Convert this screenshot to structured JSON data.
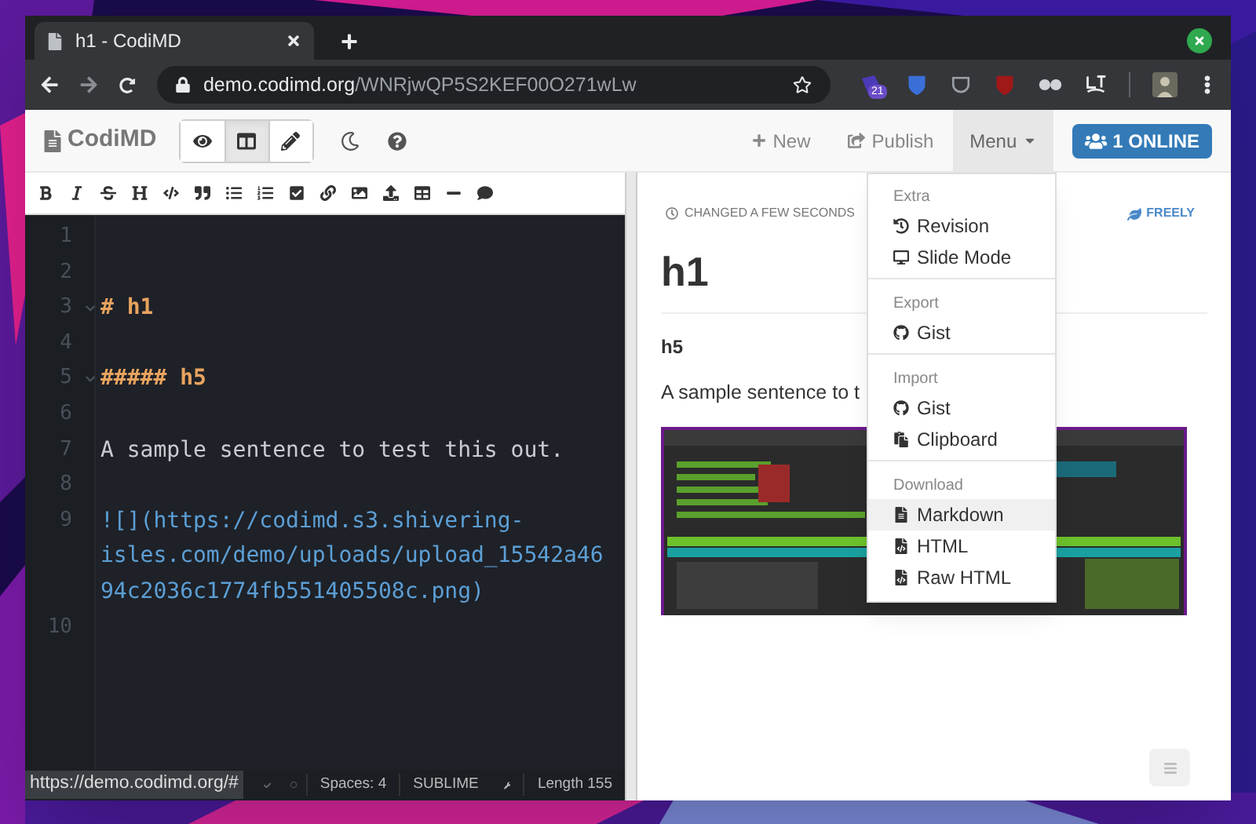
{
  "browser": {
    "tab_title": "h1 - CodiMD",
    "url_host": "demo.codimd.org",
    "url_path": "/WNRjwQP5S2KEF00O271wLw",
    "extension_badge": "21"
  },
  "navbar": {
    "brand": "CodiMD",
    "view_modes": [
      {
        "kind": "view",
        "selected": false
      },
      {
        "kind": "both",
        "selected": true
      },
      {
        "kind": "edit",
        "selected": false
      }
    ],
    "new": "New",
    "publish": "Publish",
    "menu": "Menu",
    "menu_open": true,
    "online": "1 ONLINE"
  },
  "editor": {
    "lines": [
      {
        "number": "1",
        "kind": "blank",
        "foldable": false
      },
      {
        "number": "2",
        "kind": "blank",
        "foldable": false
      },
      {
        "number": "3",
        "kind": "heading",
        "text": "# h1",
        "foldable": true
      },
      {
        "number": "4",
        "kind": "blank",
        "foldable": false
      },
      {
        "number": "5",
        "kind": "heading",
        "text": "##### h5",
        "foldable": true
      },
      {
        "number": "6",
        "kind": "blank",
        "foldable": false
      },
      {
        "number": "7",
        "kind": "text",
        "text": "A sample sentence to test this out.",
        "foldable": false
      },
      {
        "number": "8",
        "kind": "blank",
        "foldable": false
      },
      {
        "number": "9",
        "kind": "link",
        "text": "![](https://codimd.s3.shivering-isles.com/demo/uploads/upload_15542a4694c2036c1774fb551405508c.png)",
        "foldable": false
      },
      {
        "number": "10",
        "kind": "blank",
        "foldable": false
      }
    ]
  },
  "status_bar": {
    "link_preview": "https://demo.codimd.org/#",
    "spaces": "Spaces: 4",
    "keymap": "SUBLIME",
    "length": "Length 155"
  },
  "preview": {
    "changed": "CHANGED A FEW SECONDS",
    "permission": "FREELY",
    "blocks": [
      {
        "kind": "h1",
        "text": "h1"
      },
      {
        "kind": "h5",
        "text": "h5"
      },
      {
        "kind": "paragraph",
        "text": "A sample sentence to t"
      },
      {
        "kind": "picture"
      }
    ]
  },
  "menu": {
    "sections": [
      {
        "title": "Extra",
        "items": [
          {
            "label": "Revision",
            "highlighted": false
          },
          {
            "label": "Slide Mode",
            "highlighted": false
          }
        ]
      },
      {
        "title": "Export",
        "items": [
          {
            "label": "Gist",
            "highlighted": false
          }
        ]
      },
      {
        "title": "Import",
        "items": [
          {
            "label": "Gist",
            "highlighted": false
          },
          {
            "label": "Clipboard",
            "highlighted": false
          }
        ]
      },
      {
        "title": "Download",
        "items": [
          {
            "label": "Markdown",
            "highlighted": true
          },
          {
            "label": "HTML",
            "highlighted": false
          },
          {
            "label": "Raw HTML",
            "highlighted": false
          }
        ]
      }
    ]
  }
}
